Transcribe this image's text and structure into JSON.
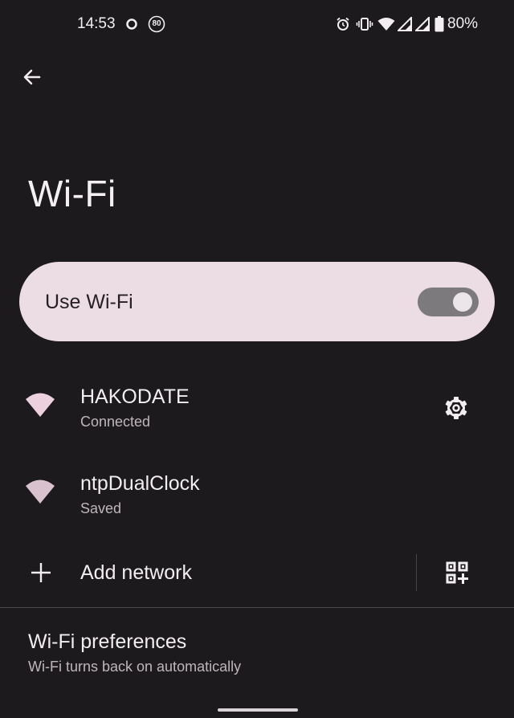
{
  "status_bar": {
    "time": "14:53",
    "notification_badge": "80",
    "battery": "80%",
    "icons": [
      "circle-notification-icon",
      "speed-badge-icon",
      "alarm-icon",
      "vibrate-icon",
      "wifi-status-icon",
      "signal-icon",
      "signal-icon",
      "battery-icon"
    ]
  },
  "header": {
    "back": "back-arrow-icon",
    "title": "Wi-Fi"
  },
  "main_toggle": {
    "label": "Use Wi-Fi",
    "enabled": true
  },
  "networks": [
    {
      "name": "HAKODATE",
      "status": "Connected",
      "icon": "wifi-full-icon",
      "has_settings": true
    },
    {
      "name": "ntpDualClock",
      "status": "Saved",
      "icon": "wifi-full-icon",
      "has_settings": false
    }
  ],
  "add_network": {
    "label": "Add network",
    "qr_icon": "qr-code-add-icon"
  },
  "preferences": {
    "title": "Wi-Fi preferences",
    "subtitle": "Wi-Fi turns back on automatically"
  },
  "colors": {
    "background": "#1c1a1d",
    "toggle_card": "#ecdde4",
    "accent_icon": "#ecd0de"
  }
}
